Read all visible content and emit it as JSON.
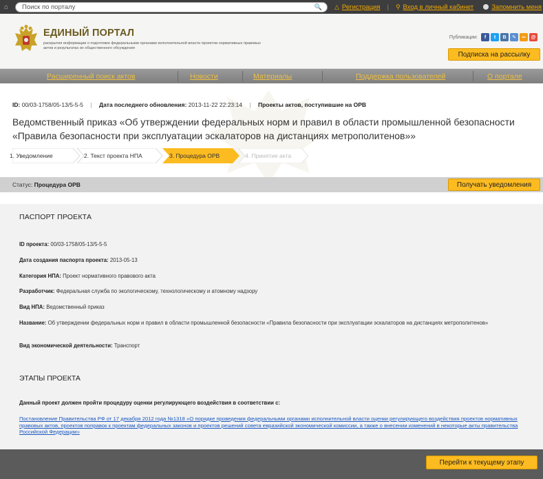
{
  "topbar": {
    "search_placeholder": "Поиск по порталу",
    "register": "Регистрация",
    "login": "Вход в личный кабинет",
    "remember": "Запомнить меня"
  },
  "header": {
    "title": "ЕДИНЫЙ ПОРТАЛ",
    "subtitle": "раскрытия информации о подготовке федеральными органами исполнительной власти проектов нормативных правовых актов и результатах их общественного обсуждения",
    "publications_label": "Публикации:",
    "subscribe": "Подписка на рассылку"
  },
  "nav": {
    "items": [
      "Расширенный поиск актов",
      "Новости",
      "Материалы",
      "Поддержка пользователей",
      "О портале"
    ]
  },
  "meta": {
    "id_label": "ID:",
    "id_value": "00/03-1758/05-13/5-5-5",
    "updated_label": "Дата последнего обновления:",
    "updated_value": "2013-11-22 22:23:14",
    "category": "Проекты актов, поступившие на ОРВ"
  },
  "doc_title": "Ведомственный приказ «Об утверждении федеральных норм и правил в области промышленной безопасности «Правила безопасности при эксплуатации эскалаторов на дистанциях метрополитенов»»",
  "steps": [
    "1. Уведомление",
    "2. Текст проекта НПА",
    "3. Процедура ОРВ",
    "4. Принятие акта"
  ],
  "status": {
    "label": "Статус:",
    "value": "Процедура ОРВ",
    "notify_button": "Получать уведомления"
  },
  "passport": {
    "title": "ПАСПОРТ ПРОЕКТА",
    "fields": [
      {
        "label": "ID проекта:",
        "value": "00/03-1758/05-13/5-5-5"
      },
      {
        "label": "Дата создания паспорта проекта:",
        "value": "2013-05-13"
      },
      {
        "label": "Категория НПА:",
        "value": "Проект нормативного правового акта"
      },
      {
        "label": "Разработчик:",
        "value": "Федеральная служба по экологическому, технологическому и атомному надзору"
      },
      {
        "label": "Вид НПА:",
        "value": "Ведомственный приказ"
      },
      {
        "label": "Название:",
        "value": "Об утверждении федеральных норм и правил в области промышленной безопасности «Правила безопасности при эксплуатации эскалаторов на дистанциях метрополитенов»"
      },
      {
        "label": "Вид экономической деятельности:",
        "value": "Транспорт"
      }
    ]
  },
  "stages": {
    "title": "ЭТАПЫ ПРОЕКТА",
    "intro": "Данный проект должен пройти процедуру оценки регулирующего воздействия в соответствии с:",
    "link": "Постановление Правительства РФ от 17 декабря 2012 года №1318 «О порядке проведения федеральными органами исполнительной власти оценки регулирующего воздействия проектов нормативных правовых актов, проектов поправок к проектам федеральных законов и проектов решений совета евразийской экономической комиссии, а также о внесении изменений в некоторые акты правительства Российской Федерации»",
    "go_button": "Перейти к текущему этапу"
  },
  "colors": {
    "accent": "#fcbb20",
    "nav_link": "#f0c040",
    "link": "#1a58c0"
  }
}
